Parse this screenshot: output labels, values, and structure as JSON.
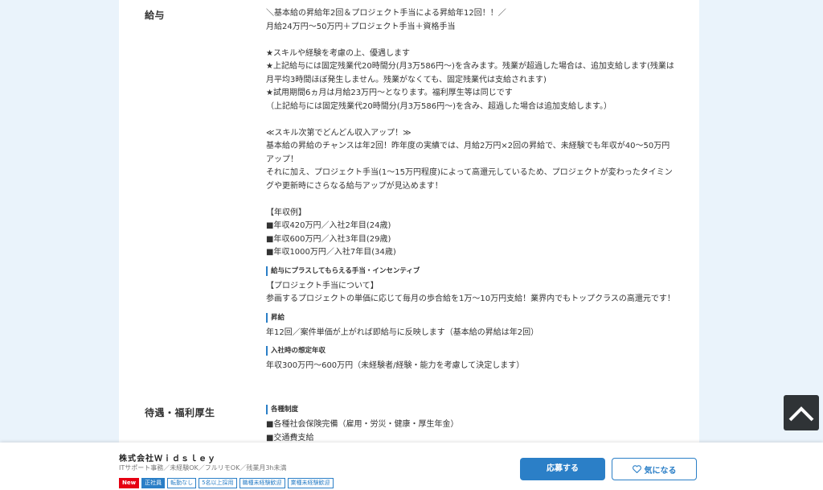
{
  "salary": {
    "label": "給与",
    "lines1": "＼基本給の昇給年2回＆プロジェクト手当による昇給年12回！！／\n月給24万円〜50万円＋プロジェクト手当＋資格手当",
    "lines2": "★スキルや経験を考慮の上、優遇します\n★上記給与には固定残業代20時間分(月3万586円〜)を含みます。残業が超過した場合は、追加支給します(残業は\n月平均3時間ほぼ発生しません。残業がなくても、固定残業代は支給されます)\n★試用期間6ヵ月は月給23万円〜となります。福利厚生等は同じです\n（上記給与には固定残業代20時間分(月3万586円〜)を含み、超過した場合は追加支給します。）",
    "lines3": "≪スキル次第でどんどん収入アップ！≫\n基本給の昇給のチャンスは年2回！昨年度の実績では、月給2万円×2回の昇給で、未経験でも年収が40〜50万円\nアップ！\nそれに加え、プロジェクト手当(1〜15万円程度)によって高還元しているため、プロジェクトが変わったタイミン\nグや更新時にさらなる給与アップが見込めます！",
    "lines4": "【年収例】\n■年収420万円／入社2年目(24歳)\n■年収600万円／入社3年目(29歳)\n■年収1000万円／入社7年目(34歳)",
    "incentive_head": "給与にプラスしてもらえる手当・インセンティブ",
    "incentive_body": "【プロジェクト手当について】\n参画するプロジェクトの単価に応じて毎月の歩合給を1万〜10万円支給！業界内でもトップクラスの高還元です！",
    "raise_head": "昇給",
    "raise_body": "年12回／案件単価が上がれば即給与に反映します（基本給の昇給は年2回）",
    "income_head": "入社時の想定年収",
    "income_body": "年収300万円〜600万円（未経験者/経験・能力を考慮して決定します）"
  },
  "benefits": {
    "label": "待遇・福利厚生",
    "systems_head": "各種制度",
    "systems_body": "■各種社会保険完備（雇用・労災・健康・厚生年金）\n■交通費支給"
  },
  "footer": {
    "company": "株式会社Ｗｉｄｓｌｅｙ",
    "subtitle": "ITサポート事務／未経験OK／フルリモOK／残業月3h未満",
    "tags": [
      "New",
      "正社員",
      "転勤なし",
      "5名以上採用",
      "職種未経験歓迎",
      "業種未経験歓迎"
    ],
    "apply_label": "応募する",
    "fav_label": "気になる"
  },
  "icons": {
    "scroll_top": "chevron-up-icon",
    "favorite": "heart-icon"
  },
  "colors": {
    "accent": "#2b7fc7",
    "new_badge": "#e60012",
    "background": "#eaf3fb"
  }
}
